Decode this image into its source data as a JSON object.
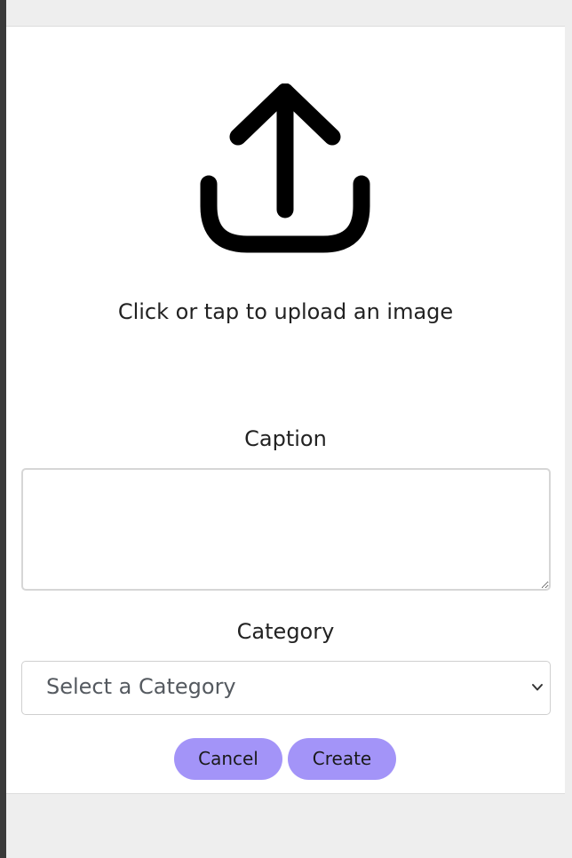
{
  "upload": {
    "icon": "upload-icon",
    "prompt": "Click or tap to upload an image"
  },
  "caption": {
    "label": "Caption",
    "value": ""
  },
  "category": {
    "label": "Category",
    "selected": "Select a Category",
    "icon": "chevron-down-icon"
  },
  "actions": {
    "cancel_label": "Cancel",
    "create_label": "Create"
  },
  "colors": {
    "button_bg": "#a394f8",
    "page_bg": "#eeeeee",
    "card_bg": "#ffffff"
  }
}
